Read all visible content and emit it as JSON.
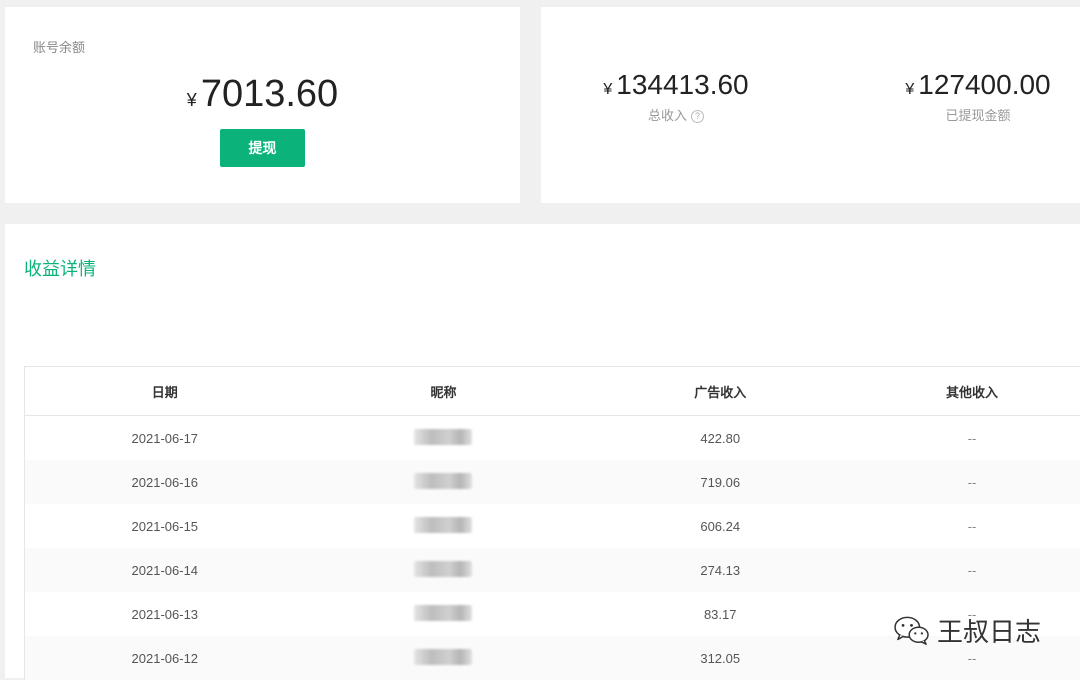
{
  "balance": {
    "label": "账号余额",
    "currency": "¥",
    "amount": "7013.60",
    "withdraw_label": "提现"
  },
  "stats": [
    {
      "currency": "¥",
      "amount": "134413.60",
      "caption": "总收入",
      "help_icon": "?"
    },
    {
      "currency": "¥",
      "amount": "127400.00",
      "caption": "已提现金额"
    }
  ],
  "detail": {
    "title": "收益详情",
    "columns": [
      "日期",
      "昵称",
      "广告收入",
      "其他收入"
    ],
    "rows": [
      {
        "date": "2021-06-17",
        "ad_income": "422.80",
        "other_income": "--"
      },
      {
        "date": "2021-06-16",
        "ad_income": "719.06",
        "other_income": "--"
      },
      {
        "date": "2021-06-15",
        "ad_income": "606.24",
        "other_income": "--"
      },
      {
        "date": "2021-06-14",
        "ad_income": "274.13",
        "other_income": "--"
      },
      {
        "date": "2021-06-13",
        "ad_income": "83.17",
        "other_income": "--"
      },
      {
        "date": "2021-06-12",
        "ad_income": "312.05",
        "other_income": "--"
      }
    ]
  },
  "watermark": {
    "text": "王叔日志",
    "icon": "wechat-icon"
  },
  "colors": {
    "accent": "#0bb37b",
    "background": "#f0f0f0",
    "card": "#ffffff",
    "row_alt": "#fafafa"
  }
}
